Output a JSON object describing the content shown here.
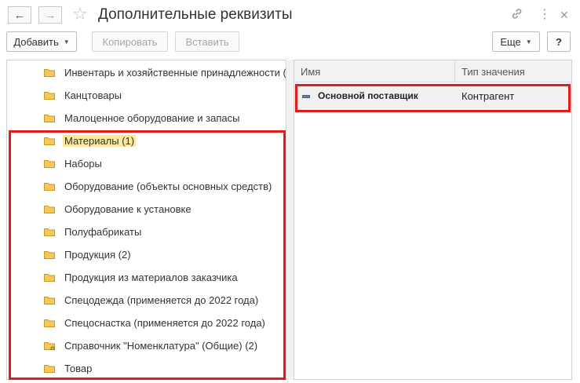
{
  "window": {
    "title": "Дополнительные реквизиты",
    "back_icon": "←",
    "forward_icon": "→",
    "star_icon": "☆",
    "link_icon": "🔗",
    "more_icon": "⋮",
    "close_icon": "✕"
  },
  "toolbar": {
    "add_label": "Добавить",
    "copy_label": "Копировать",
    "paste_label": "Вставить",
    "more_label": "Еще",
    "help_label": "?"
  },
  "tree": {
    "items": [
      {
        "label": "Инвентарь и хозяйственные принадлежности (и"
      },
      {
        "label": "Канцтовары"
      },
      {
        "label": "Малоценное оборудование и запасы"
      },
      {
        "label": "Материалы (1)"
      },
      {
        "label": "Наборы"
      },
      {
        "label": "Оборудование (объекты основных средств)"
      },
      {
        "label": "Оборудование к установке"
      },
      {
        "label": "Полуфабрикаты"
      },
      {
        "label": "Продукция (2)"
      },
      {
        "label": "Продукция из материалов заказчика"
      },
      {
        "label": "Спецодежда (применяется до 2022 года)"
      },
      {
        "label": "Спецоснастка (применяется до 2022 года)"
      },
      {
        "label": "Справочник \"Номенклатура\" (Общие) (2)"
      },
      {
        "label": "Товар"
      }
    ]
  },
  "grid": {
    "columns": [
      "Имя",
      "Тип значения"
    ],
    "rows": [
      {
        "name": "Основной поставщик",
        "type": "Контрагент"
      }
    ]
  },
  "colors": {
    "accent_red": "#e21b1b",
    "folder_fill": "#f5c858",
    "selection": "#fbe7a0"
  }
}
